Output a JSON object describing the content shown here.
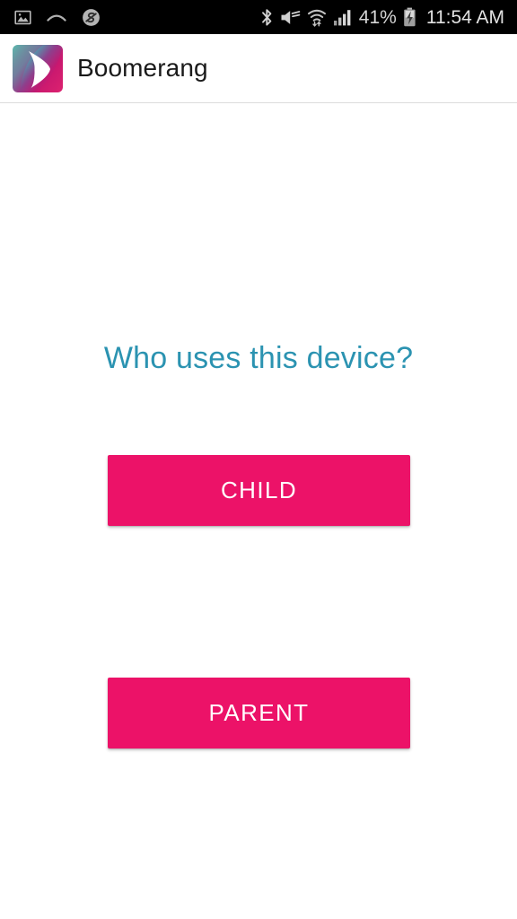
{
  "status_bar": {
    "background_color": "#000000",
    "left_icons": [
      {
        "name": "screenshot-image-icon",
        "label": "screenshot captured"
      },
      {
        "name": "chevron-up-icon",
        "label": "collapse notifications"
      },
      {
        "name": "app-notification-icon",
        "label": "app notification"
      }
    ],
    "right_icons": [
      {
        "name": "bluetooth-icon",
        "label": "Bluetooth on"
      },
      {
        "name": "mute-icon",
        "label": "Sound muted"
      },
      {
        "name": "wifi-icon",
        "label": "Wi-Fi connected"
      },
      {
        "name": "cellular-signal-icon",
        "label": "Cellular signal"
      }
    ],
    "battery_percent": "41%",
    "battery_charging": true,
    "clock": "11:54 AM"
  },
  "app_bar": {
    "title": "Boomerang",
    "logo_name": "boomerang-logo",
    "logo_colors": {
      "left": "#4aa0a6",
      "right": "#d81b69",
      "accent": "#ffffff"
    },
    "divider_color": "#dcdcdc"
  },
  "main": {
    "prompt": "Who uses this device?",
    "prompt_color": "#2b93b1",
    "buttons": [
      {
        "label": "CHILD",
        "name": "child-button",
        "color": "#ec1268"
      },
      {
        "label": "PARENT",
        "name": "parent-button",
        "color": "#ec1268"
      }
    ]
  }
}
